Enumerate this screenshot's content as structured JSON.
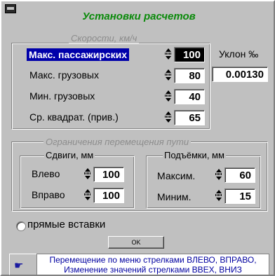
{
  "window": {
    "title": "Установки расчетов",
    "icon": "system-menu-icon"
  },
  "speeds": {
    "caption": "Скорости, км/ч",
    "rows": [
      {
        "label": "Макс. пассажирских",
        "value": "100"
      },
      {
        "label": "Макс. грузовых",
        "value": "80"
      },
      {
        "label": "Мин. грузовых",
        "value": "40"
      },
      {
        "label": "Ср. квадрат. (прив.)",
        "value": "65"
      }
    ],
    "slope_label": "Уклон ‰",
    "slope_value": "0.00130"
  },
  "limits": {
    "caption": "Ограничения перемещения пути",
    "shifts": {
      "caption": "Сдвиги, мм",
      "left_label": "Влево",
      "left_value": "100",
      "right_label": "Вправо",
      "right_value": "100"
    },
    "lifts": {
      "caption": "Подъёмки, мм",
      "max_label": "Максим.",
      "max_value": "60",
      "min_label": "Миним.",
      "min_value": "15"
    }
  },
  "straight_inserts": {
    "label": "прямые вставки",
    "checked": false
  },
  "ok_button": {
    "label": "OK"
  },
  "hint": {
    "icon": "pointing-hand-icon",
    "line1": "Перемещение по меню стрелками ВЛЕВО, ВПРАВО,",
    "line2": "Изменение значений стрелками ВВЕХ, ВНИЗ"
  }
}
